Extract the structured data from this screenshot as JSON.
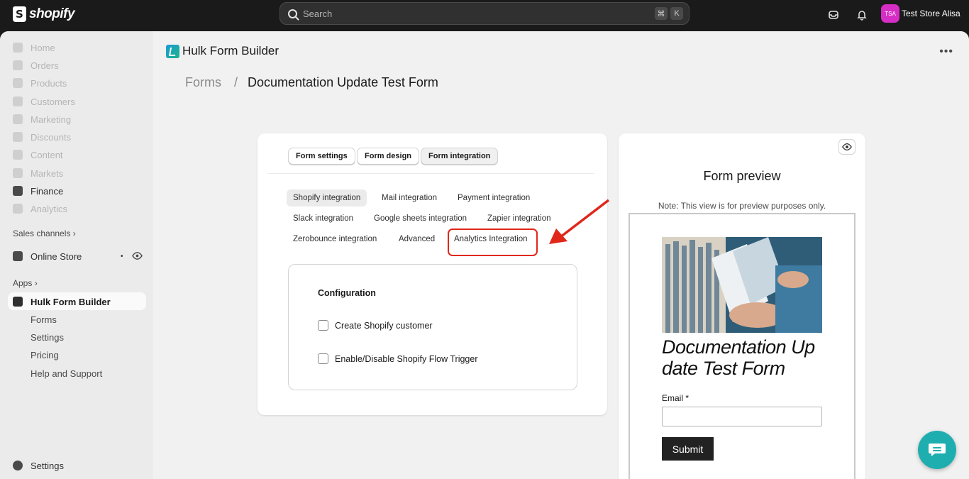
{
  "topbar": {
    "brand": "shopify",
    "search_placeholder": "Search",
    "shortcut_cmd": "⌘",
    "shortcut_key": "K",
    "avatar_initials": "TSA",
    "store_name": "Test Store Alisa"
  },
  "sidebar": {
    "items": [
      {
        "label": "Home"
      },
      {
        "label": "Orders"
      },
      {
        "label": "Products"
      },
      {
        "label": "Customers"
      },
      {
        "label": "Marketing"
      },
      {
        "label": "Discounts"
      },
      {
        "label": "Content"
      },
      {
        "label": "Markets"
      },
      {
        "label": "Finance"
      },
      {
        "label": "Analytics"
      }
    ],
    "sales_channels_label": "Sales channels",
    "online_store_label": "Online Store",
    "apps_label": "Apps",
    "app_name": "Hulk Form Builder",
    "app_subitems": [
      {
        "label": "Forms"
      },
      {
        "label": "Settings"
      },
      {
        "label": "Pricing"
      },
      {
        "label": "Help and Support"
      }
    ],
    "settings_label": "Settings"
  },
  "header": {
    "app_title": "Hulk Form Builder",
    "breadcrumb_parent": "Forms",
    "breadcrumb_separator": "/",
    "breadcrumb_current": "Documentation Update Test Form"
  },
  "form_editor": {
    "main_tabs": [
      {
        "label": "Form settings"
      },
      {
        "label": "Form design"
      },
      {
        "label": "Form integration"
      }
    ],
    "integration_tabs": [
      {
        "label": "Shopify integration"
      },
      {
        "label": "Mail integration"
      },
      {
        "label": "Payment integration"
      },
      {
        "label": "Slack integration"
      },
      {
        "label": "Google sheets integration"
      },
      {
        "label": "Zapier integration"
      },
      {
        "label": "Zerobounce integration"
      },
      {
        "label": "Advanced"
      },
      {
        "label": "Analytics Integration"
      }
    ],
    "configuration_title": "Configuration",
    "checkboxes": [
      {
        "label": "Create Shopify customer",
        "checked": false
      },
      {
        "label": "Enable/Disable Shopify Flow Trigger",
        "checked": false
      }
    ]
  },
  "preview": {
    "title": "Form preview",
    "note": "Note: This view is for preview purposes only.",
    "form_heading": "Documentation Up date Test Form",
    "email_label": "Email *",
    "submit_label": "Submit"
  },
  "colors": {
    "highlight": "#e0271a",
    "avatar": "#d62ec5",
    "chat": "#1faeb0"
  }
}
